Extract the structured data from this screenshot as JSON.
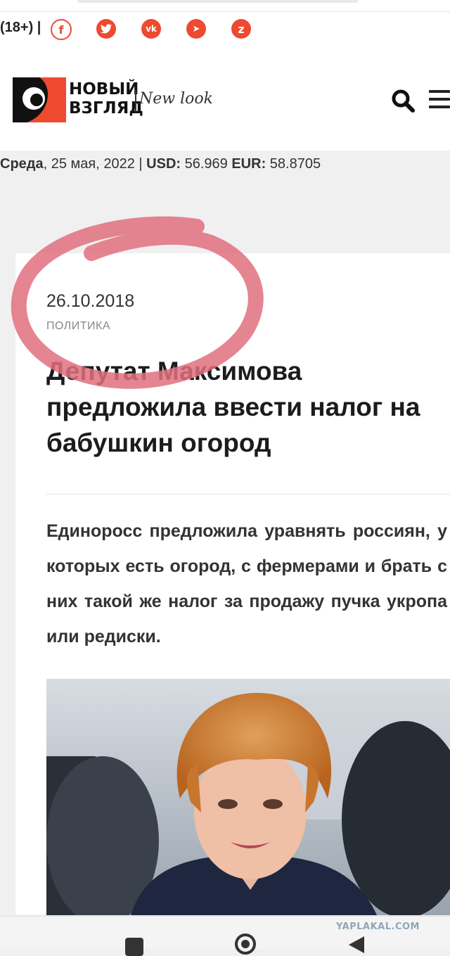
{
  "topbar": {
    "age_label": "(18+) |",
    "social": [
      {
        "icon": "facebook-icon",
        "glyph": "f"
      },
      {
        "icon": "twitter-icon",
        "glyph": "t"
      },
      {
        "icon": "vk-icon",
        "glyph": "vk"
      },
      {
        "icon": "telegram-icon",
        "glyph": "➤"
      },
      {
        "icon": "zen-icon",
        "glyph": "z"
      }
    ]
  },
  "header": {
    "logo_line1": "НОВЫЙ",
    "logo_line2": "ВЗГЛЯД",
    "logo_tagline": "New look"
  },
  "dateline": {
    "weekday": "Среда",
    "date": ", 25 мая, 2022 | ",
    "usd_label": "USD:",
    "usd_value": " 56.969 ",
    "eur_label": "EUR:",
    "eur_value": " 58.8705"
  },
  "article": {
    "date": "26.10.2018",
    "category": "ПОЛИТИКА",
    "title": "Депутат Максимова предложила ввести налог на бабушкин огород",
    "lead": "Единоросс предложила уравнять россиян, у которых есть огород, с фермерами и брать с них такой же налог за продажу пучка укропа или редиски."
  },
  "watermark": "YAPLAKAL.COM",
  "colors": {
    "accent": "#ee4a2f",
    "annotation": "#e0707e"
  }
}
